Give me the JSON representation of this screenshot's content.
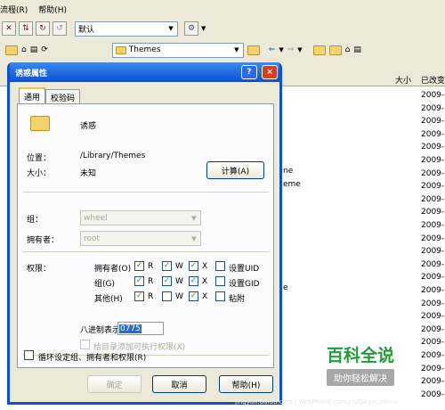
{
  "menubar": {
    "items": [
      "流程(R)",
      "帮助(H)"
    ]
  },
  "toolbar": {
    "encoding_value": "默认",
    "location_value": "Themes"
  },
  "filelist": {
    "col_size": "大小",
    "col_modified": "已改变",
    "dates": [
      "2009-",
      "2009-",
      "2009-",
      "2009-",
      "2009-",
      "2009-",
      "2009-",
      "2009-",
      "2009-",
      "2009-",
      "2009-",
      "2009-",
      "2009-",
      "2009-",
      "2009-",
      "2009-",
      "2009-",
      "2009-",
      "2009-",
      "2009-",
      "2009-",
      "2009-",
      "2009-",
      "2009-"
    ],
    "partial_items": [
      "ne",
      "eme",
      "e"
    ]
  },
  "dialog": {
    "title": "诱惑属性",
    "help_btn": "?",
    "close_btn": "×",
    "tabs": [
      "通用",
      "校验码"
    ],
    "name": "诱惑",
    "location_label": "位置：",
    "location_value": "/Library/Themes",
    "size_label": "大小：",
    "size_value": "未知",
    "calc_button": "计算(A)",
    "group_label": "组：",
    "group_value": "wheel",
    "owner_label": "拥有者：",
    "owner_value": "root",
    "perm_label": "权限：",
    "perm_rows": [
      {
        "name": "拥有者(O)",
        "r": true,
        "w": true,
        "x": true,
        "extra": "设置UID",
        "extra_checked": false
      },
      {
        "name": "组(G)",
        "r": true,
        "w": true,
        "x": true,
        "extra": "设置GID",
        "extra_checked": false
      },
      {
        "name": "其他(H)",
        "r": true,
        "w": false,
        "x": true,
        "extra": "粘附",
        "extra_checked": false
      }
    ],
    "perm_r": "R",
    "perm_w": "W",
    "perm_x": "X",
    "octal_label": "八进制表示",
    "octal_value": "0775",
    "exec_label": "给目录添加可执行权限(X)",
    "recursive_label": "循环设定组、拥有者和权限(R)",
    "ok": "确定",
    "cancel": "取消",
    "help": "帮助(H)"
  },
  "watermark": {
    "title": "百科全说",
    "subtitle": "助你轻松解决",
    "url": "jingyan.baidu.com | WebPhone.com.cn/Q4 pic.hinco"
  }
}
